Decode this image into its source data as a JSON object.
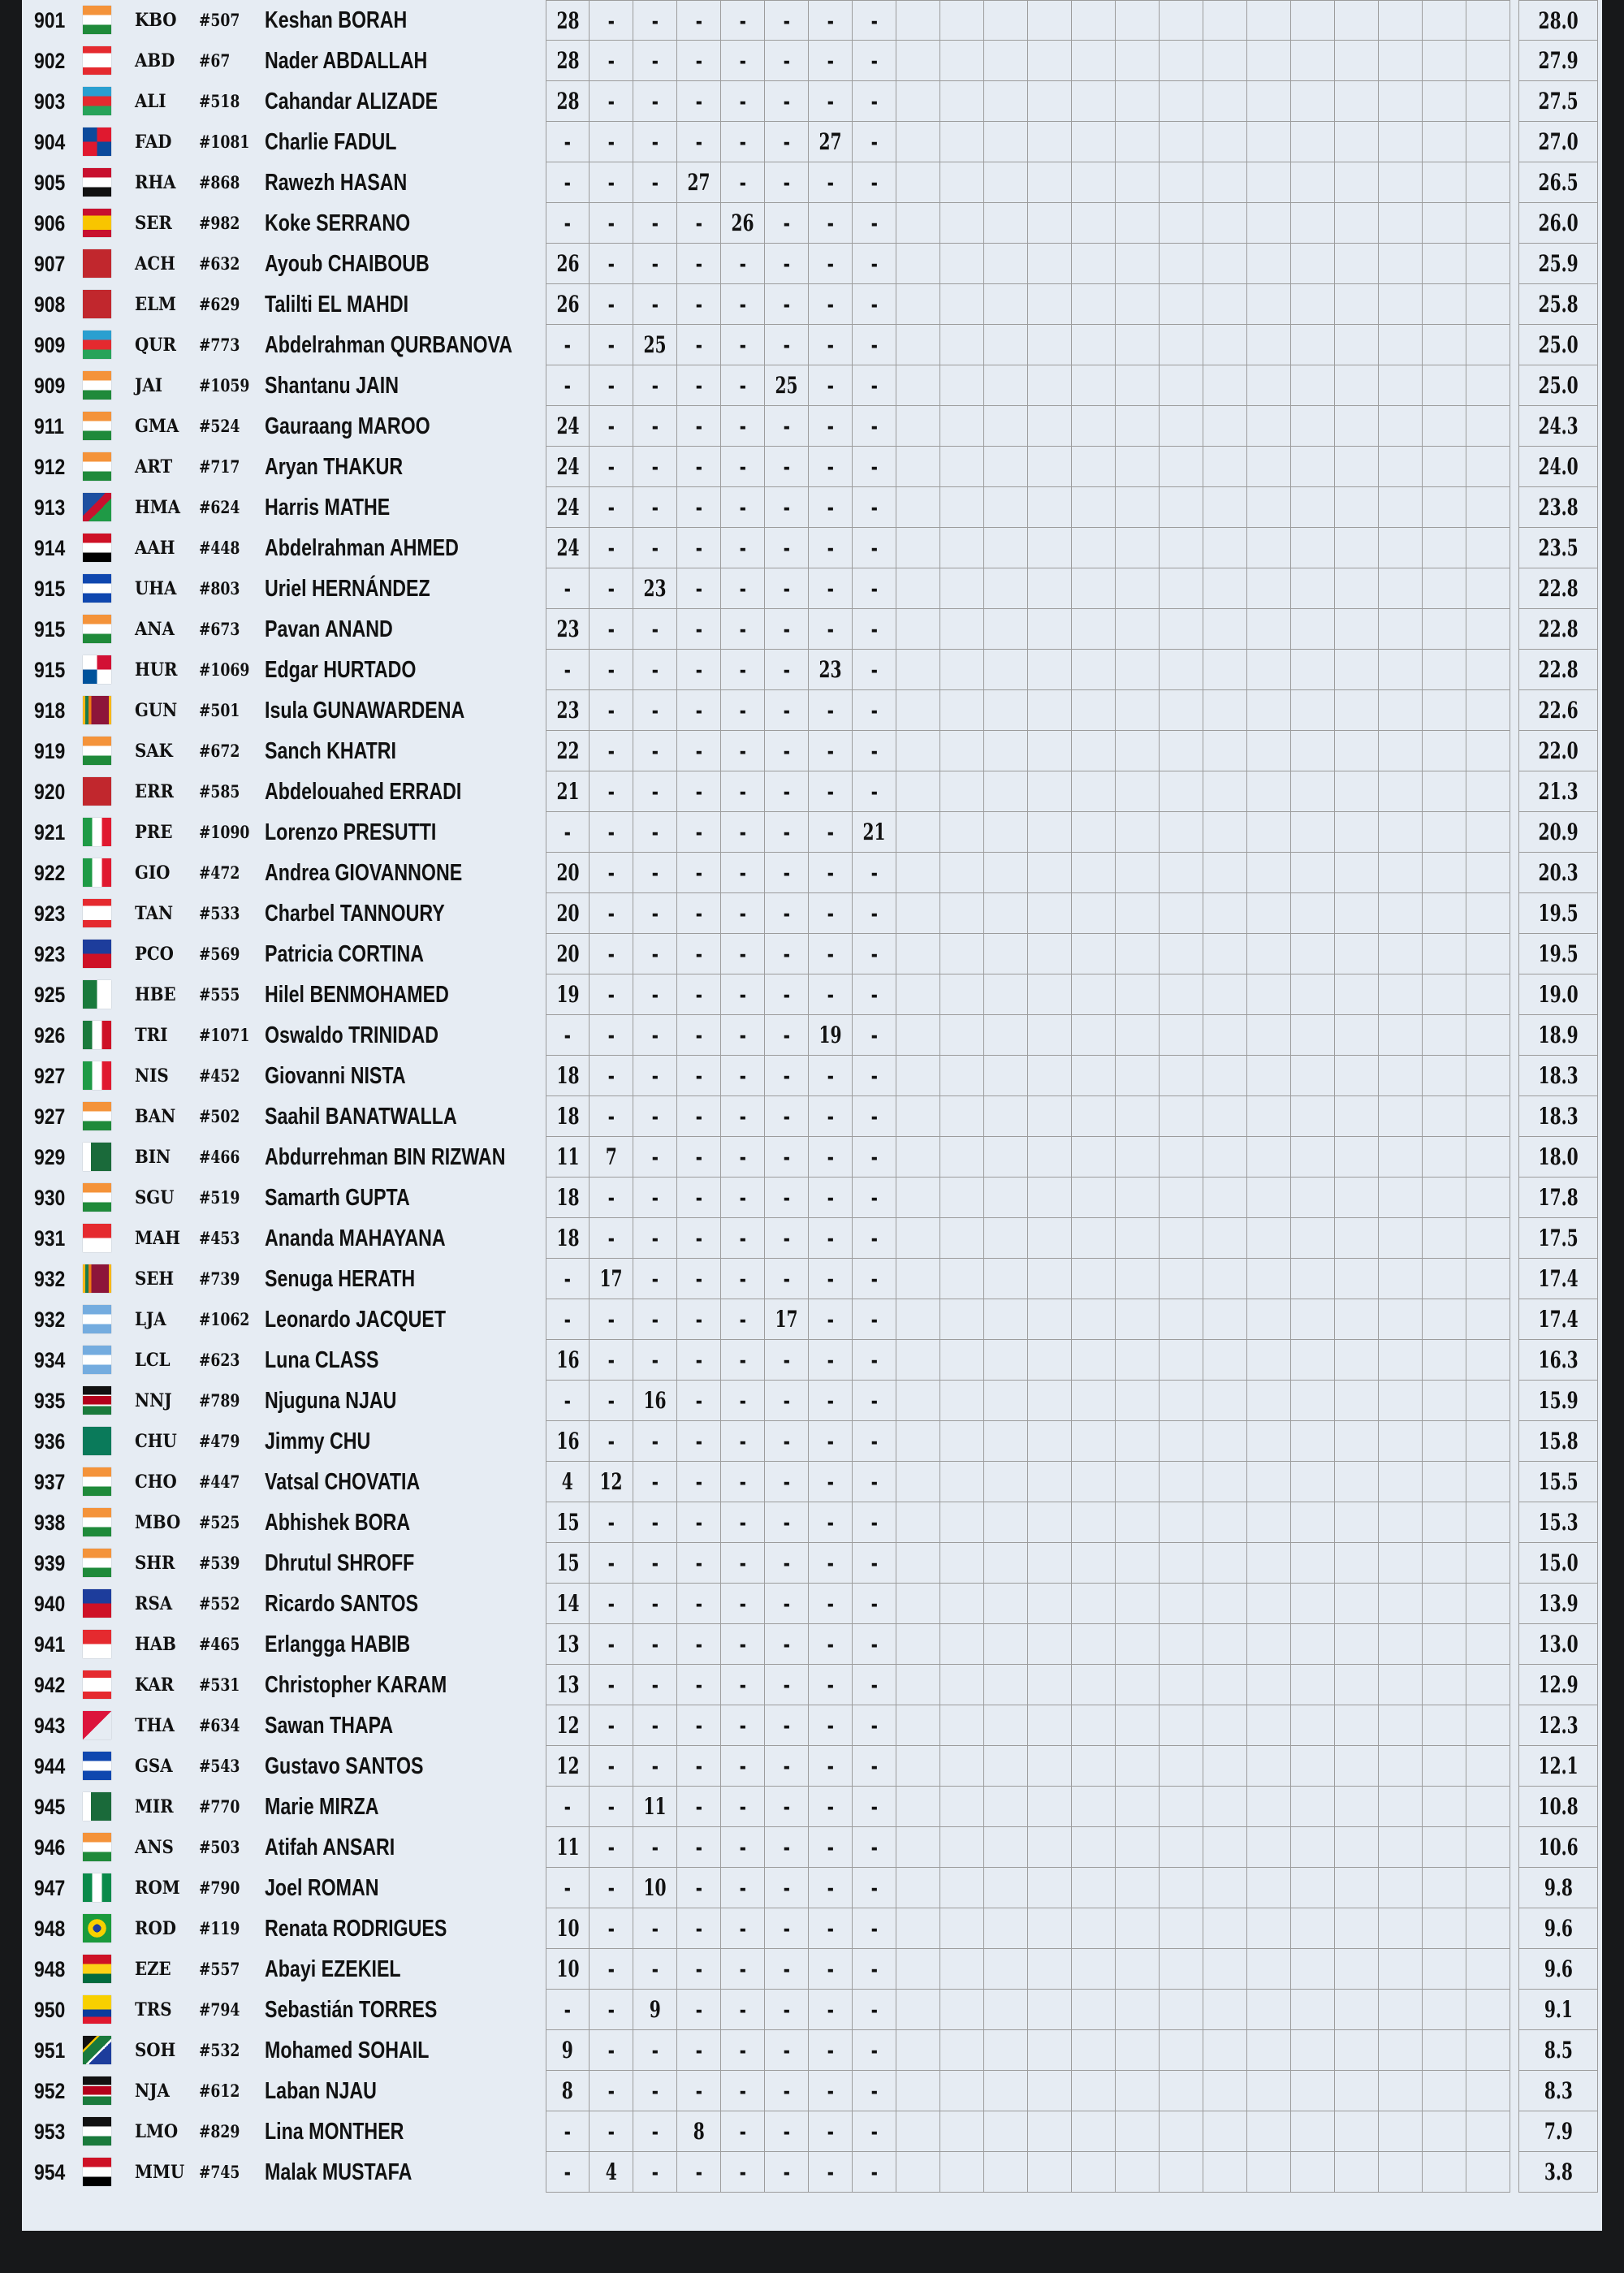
{
  "colors": {
    "background": "#e6ecf3",
    "frame": "#17181a",
    "grid": "#9c9c9c"
  },
  "empty_score": "-",
  "rows": [
    {
      "rank": "901",
      "flag": "IN",
      "code": "KBO",
      "id": "#507",
      "name": "Keshan BORAH",
      "scores": [
        "28",
        "-",
        "-",
        "-",
        "-",
        "-",
        "-",
        "-"
      ],
      "total": "28.0"
    },
    {
      "rank": "902",
      "flag": "LB",
      "code": "ABD",
      "id": "#67",
      "name": "Nader ABDALLAH",
      "scores": [
        "28",
        "-",
        "-",
        "-",
        "-",
        "-",
        "-",
        "-"
      ],
      "total": "27.9"
    },
    {
      "rank": "903",
      "flag": "AZ",
      "code": "ALI",
      "id": "#518",
      "name": "Cahandar ALIZADE",
      "scores": [
        "28",
        "-",
        "-",
        "-",
        "-",
        "-",
        "-",
        "-"
      ],
      "total": "27.5"
    },
    {
      "rank": "904",
      "flag": "DO",
      "code": "FAD",
      "id": "#1081",
      "name": "Charlie FADUL",
      "scores": [
        "-",
        "-",
        "-",
        "-",
        "-",
        "-",
        "27",
        "-"
      ],
      "total": "27.0"
    },
    {
      "rank": "905",
      "flag": "IQ",
      "code": "RHA",
      "id": "#868",
      "name": "Rawezh HASAN",
      "scores": [
        "-",
        "-",
        "-",
        "27",
        "-",
        "-",
        "-",
        "-"
      ],
      "total": "26.5"
    },
    {
      "rank": "906",
      "flag": "ES",
      "code": "SER",
      "id": "#982",
      "name": "Koke SERRANO",
      "scores": [
        "-",
        "-",
        "-",
        "-",
        "26",
        "-",
        "-",
        "-"
      ],
      "total": "26.0"
    },
    {
      "rank": "907",
      "flag": "MA",
      "code": "ACH",
      "id": "#632",
      "name": "Ayoub CHAIBOUB",
      "scores": [
        "26",
        "-",
        "-",
        "-",
        "-",
        "-",
        "-",
        "-"
      ],
      "total": "25.9"
    },
    {
      "rank": "908",
      "flag": "MA",
      "code": "ELM",
      "id": "#629",
      "name": "Talilti EL MAHDI",
      "scores": [
        "26",
        "-",
        "-",
        "-",
        "-",
        "-",
        "-",
        "-"
      ],
      "total": "25.8"
    },
    {
      "rank": "909",
      "flag": "AZ",
      "code": "QUR",
      "id": "#773",
      "name": "Abdelrahman QURBANOVA",
      "scores": [
        "-",
        "-",
        "25",
        "-",
        "-",
        "-",
        "-",
        "-"
      ],
      "total": "25.0"
    },
    {
      "rank": "909",
      "flag": "IN",
      "code": "JAI",
      "id": "#1059",
      "name": "Shantanu JAIN",
      "scores": [
        "-",
        "-",
        "-",
        "-",
        "-",
        "25",
        "-",
        "-"
      ],
      "total": "25.0"
    },
    {
      "rank": "911",
      "flag": "IN",
      "code": "GMA",
      "id": "#524",
      "name": "Gauraang MAROO",
      "scores": [
        "24",
        "-",
        "-",
        "-",
        "-",
        "-",
        "-",
        "-"
      ],
      "total": "24.3"
    },
    {
      "rank": "912",
      "flag": "IN",
      "code": "ART",
      "id": "#717",
      "name": "Aryan THAKUR",
      "scores": [
        "24",
        "-",
        "-",
        "-",
        "-",
        "-",
        "-",
        "-"
      ],
      "total": "24.0"
    },
    {
      "rank": "913",
      "flag": "NA",
      "code": "HMA",
      "id": "#624",
      "name": "Harris MATHE",
      "scores": [
        "24",
        "-",
        "-",
        "-",
        "-",
        "-",
        "-",
        "-"
      ],
      "total": "23.8"
    },
    {
      "rank": "914",
      "flag": "EG",
      "code": "AAH",
      "id": "#448",
      "name": "Abdelrahman AHMED",
      "scores": [
        "24",
        "-",
        "-",
        "-",
        "-",
        "-",
        "-",
        "-"
      ],
      "total": "23.5"
    },
    {
      "rank": "915",
      "flag": "SV",
      "code": "UHA",
      "id": "#803",
      "name": "Uriel HERNÁNDEZ",
      "scores": [
        "-",
        "-",
        "23",
        "-",
        "-",
        "-",
        "-",
        "-"
      ],
      "total": "22.8"
    },
    {
      "rank": "915",
      "flag": "IN",
      "code": "ANA",
      "id": "#673",
      "name": "Pavan ANAND",
      "scores": [
        "23",
        "-",
        "-",
        "-",
        "-",
        "-",
        "-",
        "-"
      ],
      "total": "22.8"
    },
    {
      "rank": "915",
      "flag": "PA",
      "code": "HUR",
      "id": "#1069",
      "name": "Edgar HURTADO",
      "scores": [
        "-",
        "-",
        "-",
        "-",
        "-",
        "-",
        "23",
        "-"
      ],
      "total": "22.8"
    },
    {
      "rank": "918",
      "flag": "LK",
      "code": "GUN",
      "id": "#501",
      "name": "Isula GUNAWARDENA",
      "scores": [
        "23",
        "-",
        "-",
        "-",
        "-",
        "-",
        "-",
        "-"
      ],
      "total": "22.6"
    },
    {
      "rank": "919",
      "flag": "IN",
      "code": "SAK",
      "id": "#672",
      "name": "Sanch KHATRI",
      "scores": [
        "22",
        "-",
        "-",
        "-",
        "-",
        "-",
        "-",
        "-"
      ],
      "total": "22.0"
    },
    {
      "rank": "920",
      "flag": "MA",
      "code": "ERR",
      "id": "#585",
      "name": "Abdelouahed ERRADI",
      "scores": [
        "21",
        "-",
        "-",
        "-",
        "-",
        "-",
        "-",
        "-"
      ],
      "total": "21.3"
    },
    {
      "rank": "921",
      "flag": "IT",
      "code": "PRE",
      "id": "#1090",
      "name": "Lorenzo PRESUTTI",
      "scores": [
        "-",
        "-",
        "-",
        "-",
        "-",
        "-",
        "-",
        "21"
      ],
      "total": "20.9"
    },
    {
      "rank": "922",
      "flag": "IT",
      "code": "GIO",
      "id": "#472",
      "name": "Andrea GIOVANNONE",
      "scores": [
        "20",
        "-",
        "-",
        "-",
        "-",
        "-",
        "-",
        "-"
      ],
      "total": "20.3"
    },
    {
      "rank": "923",
      "flag": "LB",
      "code": "TAN",
      "id": "#533",
      "name": "Charbel TANNOURY",
      "scores": [
        "20",
        "-",
        "-",
        "-",
        "-",
        "-",
        "-",
        "-"
      ],
      "total": "19.5"
    },
    {
      "rank": "923",
      "flag": "PH",
      "code": "PCO",
      "id": "#569",
      "name": "Patricia CORTINA",
      "scores": [
        "20",
        "-",
        "-",
        "-",
        "-",
        "-",
        "-",
        "-"
      ],
      "total": "19.5"
    },
    {
      "rank": "925",
      "flag": "DZ",
      "code": "HBE",
      "id": "#555",
      "name": "Hilel BENMOHAMED",
      "scores": [
        "19",
        "-",
        "-",
        "-",
        "-",
        "-",
        "-",
        "-"
      ],
      "total": "19.0"
    },
    {
      "rank": "926",
      "flag": "MX",
      "code": "TRI",
      "id": "#1071",
      "name": "Oswaldo TRINIDAD",
      "scores": [
        "-",
        "-",
        "-",
        "-",
        "-",
        "-",
        "19",
        "-"
      ],
      "total": "18.9"
    },
    {
      "rank": "927",
      "flag": "IT",
      "code": "NIS",
      "id": "#452",
      "name": "Giovanni NISTA",
      "scores": [
        "18",
        "-",
        "-",
        "-",
        "-",
        "-",
        "-",
        "-"
      ],
      "total": "18.3"
    },
    {
      "rank": "927",
      "flag": "IN",
      "code": "BAN",
      "id": "#502",
      "name": "Saahil BANATWALLA",
      "scores": [
        "18",
        "-",
        "-",
        "-",
        "-",
        "-",
        "-",
        "-"
      ],
      "total": "18.3"
    },
    {
      "rank": "929",
      "flag": "PK",
      "code": "BIN",
      "id": "#466",
      "name": "Abdurrehman BIN RIZWAN",
      "scores": [
        "11",
        "7",
        "-",
        "-",
        "-",
        "-",
        "-",
        "-"
      ],
      "total": "18.0"
    },
    {
      "rank": "930",
      "flag": "IN",
      "code": "SGU",
      "id": "#519",
      "name": "Samarth GUPTA",
      "scores": [
        "18",
        "-",
        "-",
        "-",
        "-",
        "-",
        "-",
        "-"
      ],
      "total": "17.8"
    },
    {
      "rank": "931",
      "flag": "ID",
      "code": "MAH",
      "id": "#453",
      "name": "Ananda MAHAYANA",
      "scores": [
        "18",
        "-",
        "-",
        "-",
        "-",
        "-",
        "-",
        "-"
      ],
      "total": "17.5"
    },
    {
      "rank": "932",
      "flag": "LK",
      "code": "SEH",
      "id": "#739",
      "name": "Senuga HERATH",
      "scores": [
        "-",
        "17",
        "-",
        "-",
        "-",
        "-",
        "-",
        "-"
      ],
      "total": "17.4"
    },
    {
      "rank": "932",
      "flag": "AR",
      "code": "LJA",
      "id": "#1062",
      "name": "Leonardo JACQUET",
      "scores": [
        "-",
        "-",
        "-",
        "-",
        "-",
        "17",
        "-",
        "-"
      ],
      "total": "17.4"
    },
    {
      "rank": "934",
      "flag": "AR",
      "code": "LCL",
      "id": "#623",
      "name": "Luna CLASS",
      "scores": [
        "16",
        "-",
        "-",
        "-",
        "-",
        "-",
        "-",
        "-"
      ],
      "total": "16.3"
    },
    {
      "rank": "935",
      "flag": "KE",
      "code": "NNJ",
      "id": "#789",
      "name": "Njuguna NJAU",
      "scores": [
        "-",
        "-",
        "16",
        "-",
        "-",
        "-",
        "-",
        "-"
      ],
      "total": "15.9"
    },
    {
      "rank": "936",
      "flag": "MO",
      "code": "CHU",
      "id": "#479",
      "name": "Jimmy CHU",
      "scores": [
        "16",
        "-",
        "-",
        "-",
        "-",
        "-",
        "-",
        "-"
      ],
      "total": "15.8"
    },
    {
      "rank": "937",
      "flag": "IN",
      "code": "CHO",
      "id": "#447",
      "name": "Vatsal CHOVATIA",
      "scores": [
        "4",
        "12",
        "-",
        "-",
        "-",
        "-",
        "-",
        "-"
      ],
      "total": "15.5"
    },
    {
      "rank": "938",
      "flag": "IN",
      "code": "MBO",
      "id": "#525",
      "name": "Abhishek BORA",
      "scores": [
        "15",
        "-",
        "-",
        "-",
        "-",
        "-",
        "-",
        "-"
      ],
      "total": "15.3"
    },
    {
      "rank": "939",
      "flag": "IN",
      "code": "SHR",
      "id": "#539",
      "name": "Dhrutul SHROFF",
      "scores": [
        "15",
        "-",
        "-",
        "-",
        "-",
        "-",
        "-",
        "-"
      ],
      "total": "15.0"
    },
    {
      "rank": "940",
      "flag": "PH",
      "code": "RSA",
      "id": "#552",
      "name": "Ricardo SANTOS",
      "scores": [
        "14",
        "-",
        "-",
        "-",
        "-",
        "-",
        "-",
        "-"
      ],
      "total": "13.9"
    },
    {
      "rank": "941",
      "flag": "ID",
      "code": "HAB",
      "id": "#465",
      "name": "Erlangga HABIB",
      "scores": [
        "13",
        "-",
        "-",
        "-",
        "-",
        "-",
        "-",
        "-"
      ],
      "total": "13.0"
    },
    {
      "rank": "942",
      "flag": "LB",
      "code": "KAR",
      "id": "#531",
      "name": "Christopher KARAM",
      "scores": [
        "13",
        "-",
        "-",
        "-",
        "-",
        "-",
        "-",
        "-"
      ],
      "total": "12.9"
    },
    {
      "rank": "943",
      "flag": "NP",
      "code": "THA",
      "id": "#634",
      "name": "Sawan THAPA",
      "scores": [
        "12",
        "-",
        "-",
        "-",
        "-",
        "-",
        "-",
        "-"
      ],
      "total": "12.3"
    },
    {
      "rank": "944",
      "flag": "SV",
      "code": "GSA",
      "id": "#543",
      "name": "Gustavo SANTOS",
      "scores": [
        "12",
        "-",
        "-",
        "-",
        "-",
        "-",
        "-",
        "-"
      ],
      "total": "12.1"
    },
    {
      "rank": "945",
      "flag": "PK",
      "code": "MIR",
      "id": "#770",
      "name": "Marie MIRZA",
      "scores": [
        "-",
        "-",
        "11",
        "-",
        "-",
        "-",
        "-",
        "-"
      ],
      "total": "10.8"
    },
    {
      "rank": "946",
      "flag": "IN",
      "code": "ANS",
      "id": "#503",
      "name": "Atifah ANSARI",
      "scores": [
        "11",
        "-",
        "-",
        "-",
        "-",
        "-",
        "-",
        "-"
      ],
      "total": "10.6"
    },
    {
      "rank": "947",
      "flag": "NG",
      "code": "ROM",
      "id": "#790",
      "name": "Joel ROMAN",
      "scores": [
        "-",
        "-",
        "10",
        "-",
        "-",
        "-",
        "-",
        "-"
      ],
      "total": "9.8"
    },
    {
      "rank": "948",
      "flag": "BR",
      "code": "ROD",
      "id": "#119",
      "name": "Renata RODRIGUES",
      "scores": [
        "10",
        "-",
        "-",
        "-",
        "-",
        "-",
        "-",
        "-"
      ],
      "total": "9.6"
    },
    {
      "rank": "948",
      "flag": "GH",
      "code": "EZE",
      "id": "#557",
      "name": "Abayi EZEKIEL",
      "scores": [
        "10",
        "-",
        "-",
        "-",
        "-",
        "-",
        "-",
        "-"
      ],
      "total": "9.6"
    },
    {
      "rank": "950",
      "flag": "EC",
      "code": "TRS",
      "id": "#794",
      "name": "Sebastián TORRES",
      "scores": [
        "-",
        "-",
        "9",
        "-",
        "-",
        "-",
        "-",
        "-"
      ],
      "total": "9.1"
    },
    {
      "rank": "951",
      "flag": "ZA",
      "code": "SOH",
      "id": "#532",
      "name": "Mohamed SOHAIL",
      "scores": [
        "9",
        "-",
        "-",
        "-",
        "-",
        "-",
        "-",
        "-"
      ],
      "total": "8.5"
    },
    {
      "rank": "952",
      "flag": "KE",
      "code": "NJA",
      "id": "#612",
      "name": "Laban NJAU",
      "scores": [
        "8",
        "-",
        "-",
        "-",
        "-",
        "-",
        "-",
        "-"
      ],
      "total": "8.3"
    },
    {
      "rank": "953",
      "flag": "JO",
      "code": "LMO",
      "id": "#829",
      "name": "Lina MONTHER",
      "scores": [
        "-",
        "-",
        "-",
        "8",
        "-",
        "-",
        "-",
        "-"
      ],
      "total": "7.9"
    },
    {
      "rank": "954",
      "flag": "EG",
      "code": "MMU",
      "id": "#745",
      "name": "Malak MUSTAFA",
      "scores": [
        "-",
        "4",
        "-",
        "-",
        "-",
        "-",
        "-",
        "-"
      ],
      "total": "3.8"
    }
  ]
}
